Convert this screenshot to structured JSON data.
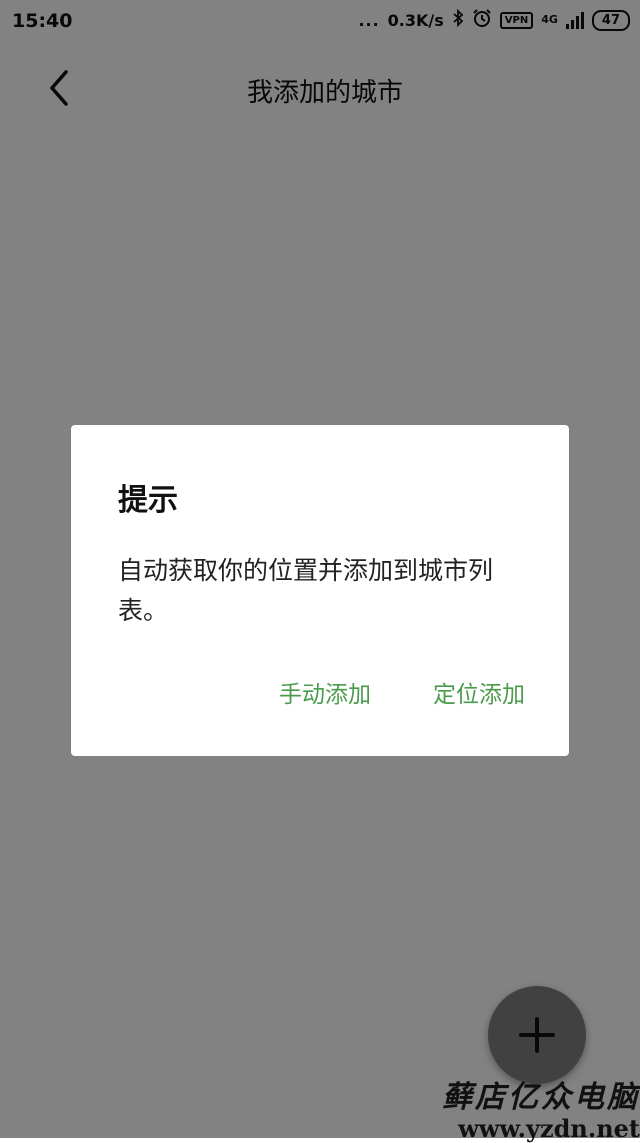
{
  "status_bar": {
    "time": "15:40",
    "dots": "...",
    "net_speed": "0.3K/s",
    "vpn": "VPN",
    "net_type": "4G",
    "battery": "47"
  },
  "header": {
    "title": "我添加的城市"
  },
  "dialog": {
    "title": "提示",
    "message": "自动获取你的位置并添加到城市列表。",
    "manual_add": "手动添加",
    "locate_add": "定位添加"
  },
  "watermark": {
    "line1": "藓店亿众电脑",
    "line2": "www.yzdn.net"
  },
  "colors": {
    "accent": "#4a9b4c",
    "overlay": "#808080"
  }
}
